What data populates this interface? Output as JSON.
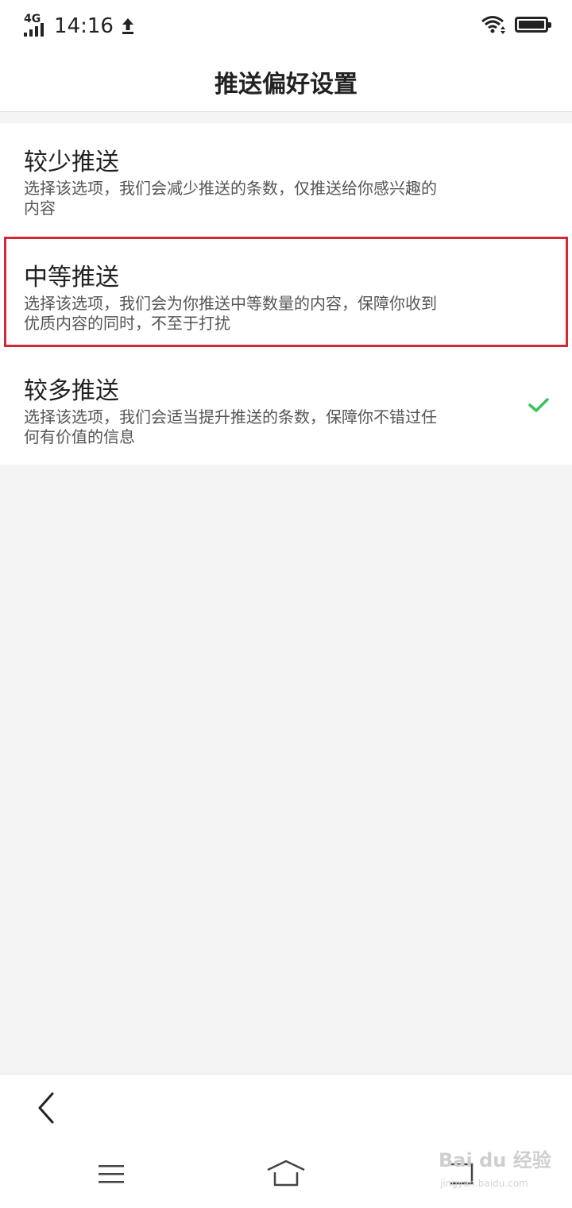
{
  "status_bar": {
    "network": "4G",
    "time": "14:16",
    "icons": [
      "signal-icon",
      "upload-icon",
      "wifi-icon",
      "battery-icon"
    ]
  },
  "header": {
    "title": "推送偏好设置"
  },
  "options": [
    {
      "title": "较少推送",
      "description": "选择该选项，我们会减少推送的条数，仅推送给你感兴趣的内容",
      "selected": false,
      "highlighted": false
    },
    {
      "title": "中等推送",
      "description": "选择该选项，我们会为你推送中等数量的内容，保障你收到优质内容的同时，不至于打扰",
      "selected": false,
      "highlighted": true
    },
    {
      "title": "较多推送",
      "description": "选择该选项，我们会适当提升推送的条数，保障你不错过任何有价值的信息",
      "selected": true,
      "highlighted": false
    }
  ],
  "navigation": {
    "back_icon": "chevron-left-icon",
    "system_buttons": [
      "menu-icon",
      "home-icon",
      "back-icon"
    ]
  },
  "watermark": {
    "text": "Bai du 经验",
    "url": "jingyan.baidu.com"
  },
  "colors": {
    "highlight_border": "#d32833",
    "check": "#3cc25a",
    "page_background": "#f4f4f4"
  }
}
